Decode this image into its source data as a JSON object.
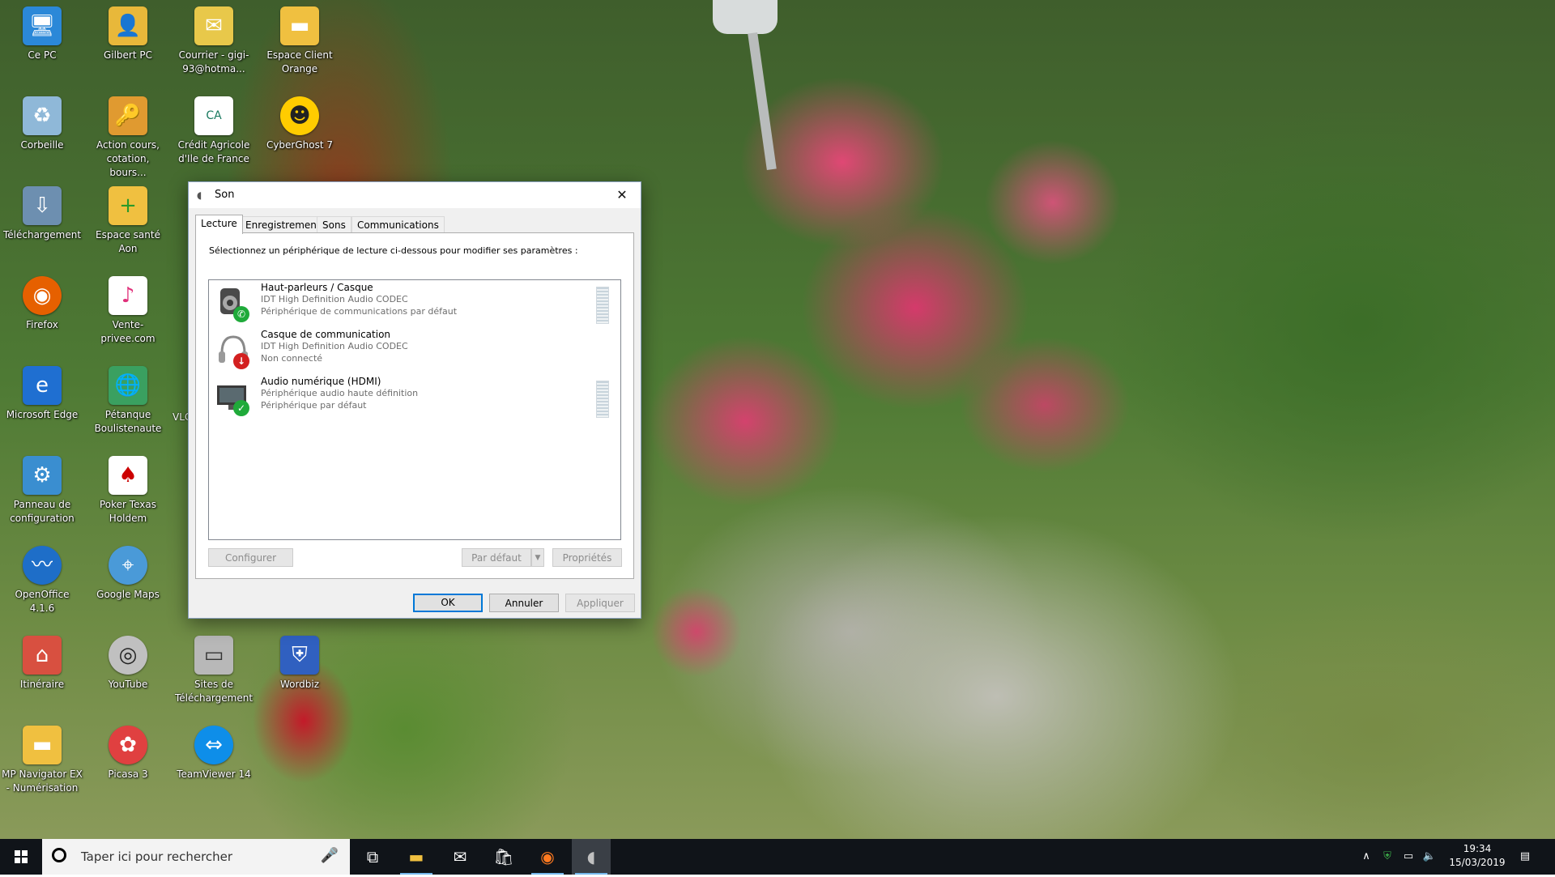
{
  "desktop": {
    "icons": [
      {
        "label": "Ce PC",
        "icon": "computer-icon",
        "color": "#2b88d8"
      },
      {
        "label": "Gilbert PC",
        "icon": "user-folder-icon",
        "color": "#e8b83a"
      },
      {
        "label": "Courrier - gigi-93@hotma...",
        "icon": "mail-folder-icon",
        "color": "#e8c84a"
      },
      {
        "label": "Espace Client Orange",
        "icon": "folder-icon",
        "color": "#f0c040"
      },
      {
        "label": "Corbeille",
        "icon": "recycle-bin-icon",
        "color": "#8fb8d8"
      },
      {
        "label": "Action cours, cotation, bours...",
        "icon": "key-icon",
        "color": "#e09a30"
      },
      {
        "label": "Crédit Agricole d'Ile de France",
        "icon": "bank-icon",
        "color": "#ffffff"
      },
      {
        "label": "CyberGhost 7",
        "icon": "ghost-icon",
        "color": "#ffcc00"
      },
      {
        "label": "Téléchargement",
        "icon": "download-icon",
        "color": "#6d8fb0"
      },
      {
        "label": "Espace santé Aon",
        "icon": "folder-plus-icon",
        "color": "#f0c040"
      },
      {
        "label": "Firefox",
        "icon": "firefox-icon",
        "color": "#e66000"
      },
      {
        "label": "Vente-privee.com",
        "icon": "shop-icon",
        "color": "#ffffff"
      },
      {
        "label": "Microsoft Edge",
        "icon": "edge-icon",
        "color": "#1f6fd1"
      },
      {
        "label": "Pétanque Boulistenaute",
        "icon": "globe-icon",
        "color": "#3aa060"
      },
      {
        "label": "Panneau de configuration",
        "icon": "control-panel-icon",
        "color": "#3a8ed0"
      },
      {
        "label": "Poker Texas Holdem",
        "icon": "cards-icon",
        "color": "#ffffff"
      },
      {
        "label": "OpenOffice 4.1.6",
        "icon": "openoffice-icon",
        "color": "#1e6ec8"
      },
      {
        "label": "Google Maps",
        "icon": "maps-icon",
        "color": "#4a9ad8"
      },
      {
        "label": "Itinéraire",
        "icon": "house-icon",
        "color": "#d85040"
      },
      {
        "label": "YouTube",
        "icon": "dvd-icon",
        "color": "#c0c0c0"
      },
      {
        "label": "Sites de Téléchargement",
        "icon": "drive-icon",
        "color": "#b8b8b8"
      },
      {
        "label": "Wordbiz",
        "icon": "shield-icon",
        "color": "#3060c0"
      },
      {
        "label": "MP Navigator EX - Numérisation",
        "icon": "folder-icon",
        "color": "#f0c040"
      },
      {
        "label": "Picasa 3",
        "icon": "picasa-icon",
        "color": "#e04040"
      },
      {
        "label": "TeamViewer 14",
        "icon": "teamviewer-icon",
        "color": "#0e8ee9"
      }
    ],
    "partial_label": "VLC"
  },
  "dialog": {
    "title": "Son",
    "close_glyph": "✕",
    "tabs": [
      {
        "label": "Lecture",
        "active": true
      },
      {
        "label": "Enregistrement",
        "active": false
      },
      {
        "label": "Sons",
        "active": false
      },
      {
        "label": "Communications",
        "active": false
      }
    ],
    "instruction": "Sélectionnez un périphérique de lecture ci-dessous pour modifier ses paramètres :",
    "devices": [
      {
        "name": "Haut-parleurs / Casque",
        "driver": "IDT High Definition Audio CODEC",
        "status": "Périphérique de communications par défaut",
        "icon": "speaker-icon",
        "badge": "phone-badge-icon",
        "badge_color": "#1faa3a"
      },
      {
        "name": "Casque de communication",
        "driver": "IDT High Definition Audio CODEC",
        "status": "Non connecté",
        "icon": "headset-icon",
        "badge": "disconnected-badge-icon",
        "badge_color": "#d32020"
      },
      {
        "name": "Audio numérique (HDMI)",
        "driver": "Périphérique audio haute définition",
        "status": "Périphérique par défaut",
        "icon": "monitor-icon",
        "badge": "check-badge-icon",
        "badge_color": "#1faa3a"
      }
    ],
    "buttons": {
      "configure": "Configurer",
      "set_default": "Par défaut",
      "properties": "Propriétés",
      "ok": "OK",
      "cancel": "Annuler",
      "apply": "Appliquer"
    }
  },
  "taskbar": {
    "search_placeholder": "Taper ici pour rechercher",
    "clock_time": "19:34",
    "clock_date": "15/03/2019",
    "accent": "#76b9ed",
    "apps": [
      {
        "name": "task-view",
        "icon": "task-view-icon"
      },
      {
        "name": "file-explorer",
        "icon": "folder-icon"
      },
      {
        "name": "mail",
        "icon": "mail-icon"
      },
      {
        "name": "store",
        "icon": "store-icon"
      },
      {
        "name": "firefox",
        "icon": "firefox-icon"
      },
      {
        "name": "sound-settings",
        "icon": "sound-icon"
      }
    ]
  }
}
